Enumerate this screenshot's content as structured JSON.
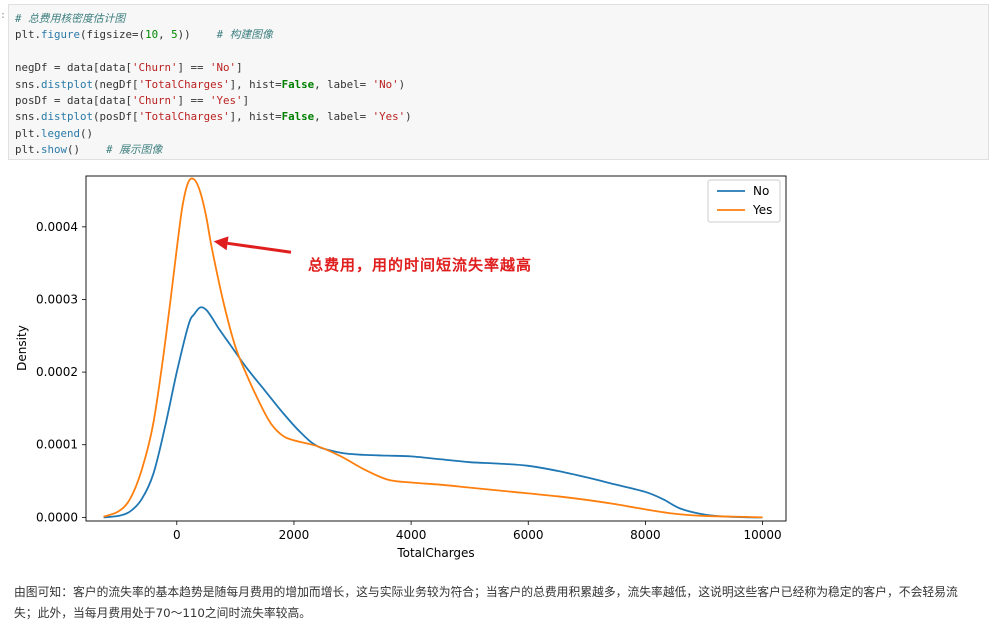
{
  "code_cell": {
    "edge_mark": ":",
    "lines": [
      [
        {
          "t": "# 总费用核密度估计图",
          "c": "c-comment"
        }
      ],
      [
        {
          "t": "plt",
          "c": ""
        },
        {
          "t": ".",
          "c": ""
        },
        {
          "t": "figure",
          "c": "c-fn"
        },
        {
          "t": "(figsize=(",
          "c": ""
        },
        {
          "t": "10",
          "c": "c-num"
        },
        {
          "t": ", ",
          "c": ""
        },
        {
          "t": "5",
          "c": "c-num"
        },
        {
          "t": "))    ",
          "c": ""
        },
        {
          "t": "# 构建图像",
          "c": "c-comment"
        }
      ],
      [
        {
          "t": "",
          "c": ""
        }
      ],
      [
        {
          "t": "negDf = data[data[",
          "c": ""
        },
        {
          "t": "'Churn'",
          "c": "c-str"
        },
        {
          "t": "] == ",
          "c": ""
        },
        {
          "t": "'No'",
          "c": "c-str"
        },
        {
          "t": "]",
          "c": ""
        }
      ],
      [
        {
          "t": "sns",
          "c": ""
        },
        {
          "t": ".",
          "c": ""
        },
        {
          "t": "distplot",
          "c": "c-fn"
        },
        {
          "t": "(negDf[",
          "c": ""
        },
        {
          "t": "'TotalCharges'",
          "c": "c-str"
        },
        {
          "t": "], hist=",
          "c": ""
        },
        {
          "t": "False",
          "c": "c-kw"
        },
        {
          "t": ", label= ",
          "c": ""
        },
        {
          "t": "'No'",
          "c": "c-str"
        },
        {
          "t": ")",
          "c": ""
        }
      ],
      [
        {
          "t": "posDf = data[data[",
          "c": ""
        },
        {
          "t": "'Churn'",
          "c": "c-str"
        },
        {
          "t": "] == ",
          "c": ""
        },
        {
          "t": "'Yes'",
          "c": "c-str"
        },
        {
          "t": "]",
          "c": ""
        }
      ],
      [
        {
          "t": "sns",
          "c": ""
        },
        {
          "t": ".",
          "c": ""
        },
        {
          "t": "distplot",
          "c": "c-fn"
        },
        {
          "t": "(posDf[",
          "c": ""
        },
        {
          "t": "'TotalCharges'",
          "c": "c-str"
        },
        {
          "t": "], hist=",
          "c": ""
        },
        {
          "t": "False",
          "c": "c-kw"
        },
        {
          "t": ", label= ",
          "c": ""
        },
        {
          "t": "'Yes'",
          "c": "c-str"
        },
        {
          "t": ")",
          "c": ""
        }
      ],
      [
        {
          "t": "plt",
          "c": ""
        },
        {
          "t": ".",
          "c": ""
        },
        {
          "t": "legend",
          "c": "c-fn"
        },
        {
          "t": "()",
          "c": ""
        }
      ],
      [
        {
          "t": "plt",
          "c": ""
        },
        {
          "t": ".",
          "c": ""
        },
        {
          "t": "show",
          "c": "c-fn"
        },
        {
          "t": "()    ",
          "c": ""
        },
        {
          "t": "# 展示图像",
          "c": "c-comment"
        }
      ]
    ]
  },
  "chart_data": {
    "type": "line",
    "xlabel": "TotalCharges",
    "ylabel": "Density",
    "xlim": [
      -1550,
      10400
    ],
    "ylim": [
      -5e-06,
      0.00047
    ],
    "x_ticks": [
      0,
      2000,
      4000,
      6000,
      8000,
      10000
    ],
    "x_tick_labels": [
      "0",
      "2000",
      "4000",
      "6000",
      "8000",
      "10000"
    ],
    "y_ticks": [
      0,
      0.0001,
      0.0002,
      0.0003,
      0.0004
    ],
    "y_tick_labels": [
      "0.0000",
      "0.0001",
      "0.0002",
      "0.0003",
      "0.0004"
    ],
    "legend_position": "top-right",
    "series": [
      {
        "name": "No",
        "color": "#1f77b4",
        "x": [
          -1250,
          -1000,
          -800,
          -600,
          -400,
          -200,
          0,
          200,
          300,
          400,
          500,
          600,
          700,
          900,
          1200,
          1500,
          1800,
          2100,
          2400,
          2800,
          3200,
          3600,
          4000,
          4500,
          5000,
          5500,
          6000,
          6500,
          7000,
          7500,
          8000,
          8300,
          8600,
          9000,
          9400,
          9800,
          10000
        ],
        "y": [
          0.0,
          2e-06,
          8e-06,
          2.5e-05,
          6e-05,
          0.000125,
          0.0002,
          0.000265,
          0.00028,
          0.000289,
          0.000286,
          0.000275,
          0.000262,
          0.000239,
          0.000205,
          0.000175,
          0.000145,
          0.000118,
          9.8e-05,
          8.9e-05,
          8.6e-05,
          8.5e-05,
          8.4e-05,
          8e-05,
          7.6e-05,
          7.4e-05,
          7.1e-05,
          6.4e-05,
          5.5e-05,
          4.5e-05,
          3.5e-05,
          2.5e-05,
          1.2e-05,
          4e-06,
          1e-06,
          0.0,
          0.0
        ]
      },
      {
        "name": "Yes",
        "color": "#ff7f0e",
        "x": [
          -1250,
          -1000,
          -800,
          -600,
          -400,
          -200,
          0,
          100,
          200,
          300,
          400,
          500,
          600,
          800,
          1000,
          1200,
          1400,
          1600,
          1800,
          2000,
          2400,
          2800,
          3200,
          3600,
          4000,
          4500,
          5000,
          5500,
          6000,
          6500,
          7000,
          7500,
          8000,
          8500,
          9000,
          9500,
          10000
        ],
        "y": [
          1e-06,
          8e-06,
          2.5e-05,
          6.5e-05,
          0.00013,
          0.00024,
          0.00037,
          0.00043,
          0.000462,
          0.000465,
          0.000448,
          0.000415,
          0.00037,
          0.000295,
          0.000235,
          0.000195,
          0.00016,
          0.00013,
          0.000113,
          0.000106,
          9.8e-05,
          8.4e-05,
          6.6e-05,
          5.2e-05,
          4.8e-05,
          4.5e-05,
          4.1e-05,
          3.7e-05,
          3.3e-05,
          2.9e-05,
          2.4e-05,
          1.8e-05,
          1.1e-05,
          5e-06,
          2e-06,
          1e-06,
          0.0
        ]
      }
    ],
    "annotation": {
      "text": "总费用，用的时间短流失率越高",
      "color": "#e01e1e",
      "arrow_target": [
        630,
        0.00038
      ],
      "arrow_from": [
        1950,
        0.000365
      ]
    }
  },
  "footer": {
    "text": "由图可知：客户的流失率的基本趋势是随每月费用的增加而增长，这与实际业务较为符合；当客户的总费用积累越多，流失率越低，这说明这些客户已经称为稳定的客户，不会轻易流失；此外，当每月费用处于70～110之间时流失率较高。"
  }
}
